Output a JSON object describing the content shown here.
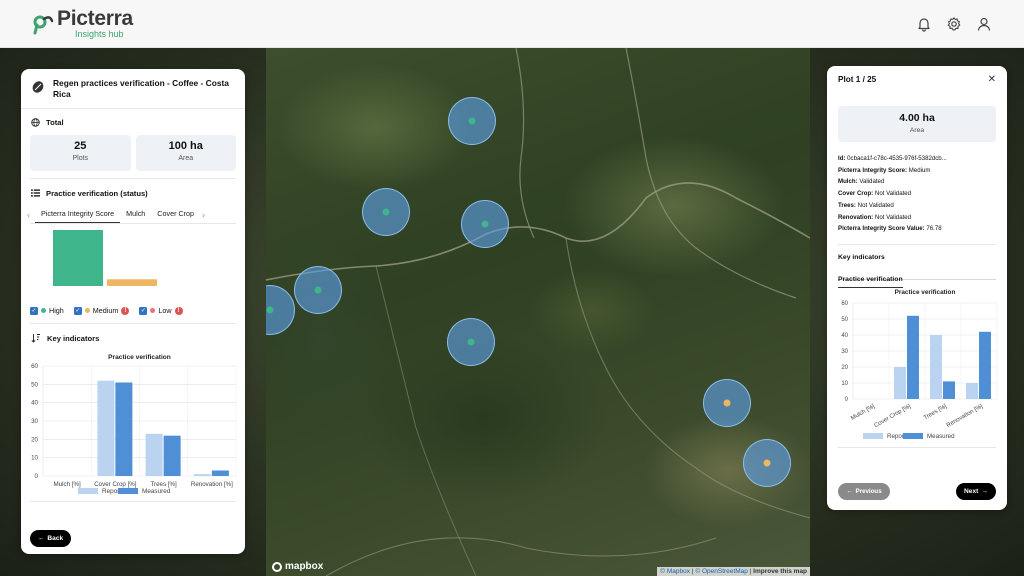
{
  "header": {
    "logo_name": "Picterra",
    "logo_subtitle": "Insights hub",
    "icons": [
      "bell-icon",
      "gear-icon",
      "user-icon"
    ]
  },
  "left_panel": {
    "title": "Regen practices verification - Coffee - Costa Rica",
    "total": {
      "heading": "Total",
      "plots_value": "25",
      "plots_label": "Plots",
      "area_value": "100 ha",
      "area_label": "Area"
    },
    "practice_status": {
      "heading": "Practice verification (status)",
      "tabs": [
        "Picterra Integrity Score",
        "Mulch",
        "Cover Crop"
      ],
      "active_tab": 0,
      "legend": [
        {
          "label": "High",
          "color": "#3fb58c",
          "warning": ""
        },
        {
          "label": "Medium",
          "color": "#eeb562",
          "warning": "!"
        },
        {
          "label": "Low",
          "color": "#e9737c",
          "warning": "!"
        }
      ]
    },
    "key_indicators_heading": "Key indicators",
    "back_label": "Back"
  },
  "right_panel": {
    "title": "Plot 1 / 25",
    "area_value": "4.00 ha",
    "area_label": "Area",
    "details": [
      {
        "key": "Id:",
        "value": "0cbaca1f-c78c-4535-976f-5382dcb..."
      },
      {
        "key": "Picterra Integrity Score:",
        "value": "Medium"
      },
      {
        "key": "Mulch:",
        "value": "Validated"
      },
      {
        "key": "Cover Crop:",
        "value": "Not Validated"
      },
      {
        "key": "Trees:",
        "value": "Not Validated"
      },
      {
        "key": "Renovation:",
        "value": "Not Validated"
      },
      {
        "key": "Picterra Integrity Score Value:",
        "value": "76.78"
      }
    ],
    "key_indicators_heading": "Key indicators",
    "tab_label": "Practice verification",
    "previous_label": "Previous",
    "next_label": "Next"
  },
  "map": {
    "mapbox_label": "mapbox",
    "attribution": {
      "mapbox": "© Mapbox",
      "separator": "|",
      "osm": "© OpenStreetMap",
      "improve": "Improve this map"
    },
    "plots": [
      {
        "dot_color": "#3fb58c"
      },
      {
        "dot_color": "#3fb58c"
      },
      {
        "dot_color": "#3fb58c"
      },
      {
        "dot_color": "#3fb58c"
      },
      {
        "dot_color": "#3fb58c"
      },
      {
        "dot_color": "#3fb58c"
      },
      {
        "dot_color": "#eeb562"
      },
      {
        "dot_color": "#eeb562"
      }
    ]
  },
  "colors": {
    "reported": "#b9d3f1",
    "measured": "#4f8fd6",
    "high": "#3fb58c",
    "medium": "#eeb562",
    "low": "#e9737c"
  },
  "chart_data": [
    {
      "type": "bar",
      "title": "",
      "categories": [
        "High",
        "Medium",
        "Low"
      ],
      "values": [
        25,
        3,
        0
      ],
      "xlabel": "",
      "ylabel": "",
      "grid": false
    },
    {
      "type": "bar",
      "title": "Practice verification",
      "categories": [
        "Mulch [%]",
        "Cover Crop [%]",
        "Trees [%]",
        "Renovation [%]"
      ],
      "series": [
        {
          "name": "Reported",
          "values": [
            0,
            52,
            23,
            1
          ]
        },
        {
          "name": "Measured",
          "values": [
            0,
            51,
            22,
            3
          ]
        }
      ],
      "yticks": [
        0,
        10,
        20,
        30,
        40,
        50,
        60
      ],
      "ylim": [
        0,
        60
      ],
      "grid": true,
      "legend": "bottom"
    },
    {
      "type": "bar",
      "title": "Practice verification",
      "categories": [
        "Mulch [%]",
        "Cover Crop [%]",
        "Trees [%]",
        "Renovation [%]"
      ],
      "series": [
        {
          "name": "Reported",
          "values": [
            0,
            20,
            40,
            10
          ]
        },
        {
          "name": "Measured",
          "values": [
            0,
            52,
            11,
            42
          ]
        }
      ],
      "yticks": [
        0,
        10,
        20,
        30,
        40,
        50,
        60
      ],
      "ylim": [
        0,
        60
      ],
      "grid": true,
      "legend": "bottom"
    }
  ]
}
